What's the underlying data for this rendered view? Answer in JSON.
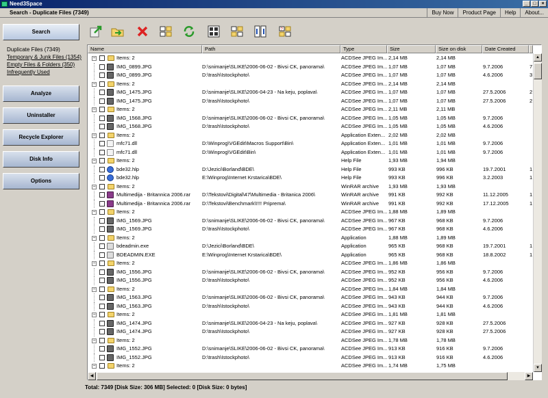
{
  "window": {
    "title": "Need3Space"
  },
  "header_bar": {
    "crumb": "Search - Duplicate Files (7349)",
    "menu": [
      "Buy Now",
      "Product Page",
      "Help",
      "About..."
    ]
  },
  "sidebar": {
    "search": "Search",
    "sub_items": [
      {
        "label": "Duplicate Files (7349)",
        "link": false
      },
      {
        "label": "Temporary & Junk Files (1354)",
        "link": true
      },
      {
        "label": "Empty Files & Folders (350)",
        "link": true
      },
      {
        "label": "Infrequently Used",
        "link": true
      }
    ],
    "analyze": "Analyze",
    "uninstaller": "Uninstaller",
    "recycle": "Recycle Explorer",
    "diskinfo": "Disk Info",
    "options": "Options"
  },
  "toolbar_icons": [
    "export-icon",
    "folder-move-icon",
    "delete-icon",
    "view-details-icon",
    "refresh-icon",
    "select-all-icon",
    "select-none-icon",
    "select-invert-icon",
    "help-icon"
  ],
  "columns": [
    "Name",
    "Path",
    "Type",
    "Size",
    "Size on disk",
    "Date Created",
    ""
  ],
  "rows": [
    {
      "kind": "group",
      "name": "Items: 2",
      "type": "ACDSee JPEG Im...",
      "size": "2,14 MB",
      "disk": "2,14 MB",
      "date": "",
      "extra": ""
    },
    {
      "kind": "file",
      "icon": "jpg",
      "name": "IMG_0899.JPG",
      "path": "D:\\snimanje\\SLIKE\\2006-06-02 - Bivsi CK, panorama\\",
      "type": "ACDSee JPEG Im...",
      "size": "1,07 MB",
      "disk": "1,07 MB",
      "date": "9.7.2006",
      "extra": "7"
    },
    {
      "kind": "file",
      "icon": "jpg",
      "name": "IMG_0899.JPG",
      "path": "D:\\trash\\Istockphoto\\",
      "type": "ACDSee JPEG Im...",
      "size": "1,07 MB",
      "disk": "1,07 MB",
      "date": "4.6.2006",
      "extra": "3"
    },
    {
      "kind": "group",
      "name": "Items: 2",
      "type": "ACDSee JPEG Im...",
      "size": "2,14 MB",
      "disk": "2,14 MB",
      "date": "",
      "extra": ""
    },
    {
      "kind": "file",
      "icon": "jpg",
      "name": "IMG_1475.JPG",
      "path": "D:\\snimanje\\SLIKE\\2006-04-23 - Na keju, poplava\\",
      "type": "ACDSee JPEG Im...",
      "size": "1,07 MB",
      "disk": "1,07 MB",
      "date": "27.5.2006",
      "extra": "2"
    },
    {
      "kind": "file",
      "icon": "jpg",
      "name": "IMG_1475.JPG",
      "path": "D:\\trash\\Istockphoto\\",
      "type": "ACDSee JPEG Im...",
      "size": "1,07 MB",
      "disk": "1,07 MB",
      "date": "27.5.2006",
      "extra": "2"
    },
    {
      "kind": "group",
      "name": "Items: 2",
      "type": "ACDSee JPEG Im...",
      "size": "2,11 MB",
      "disk": "2,11 MB",
      "date": "",
      "extra": ""
    },
    {
      "kind": "file",
      "icon": "jpg",
      "name": "IMG_1568.JPG",
      "path": "D:\\snimanje\\SLIKE\\2006-06-02 - Bivsi CK, panorama\\",
      "type": "ACDSee JPEG Im...",
      "size": "1,05 MB",
      "disk": "1,05 MB",
      "date": "9.7.2006",
      "extra": ""
    },
    {
      "kind": "file",
      "icon": "jpg",
      "name": "IMG_1568.JPG",
      "path": "D:\\trash\\Istockphoto\\",
      "type": "ACDSee JPEG Im...",
      "size": "1,05 MB",
      "disk": "1,05 MB",
      "date": "4.6.2006",
      "extra": ""
    },
    {
      "kind": "group",
      "name": "Items: 2",
      "type": "Application Exten...",
      "size": "2,02 MB",
      "disk": "2,02 MB",
      "date": "",
      "extra": ""
    },
    {
      "kind": "file",
      "icon": "dll",
      "name": "mfc71.dll",
      "path": "D:\\Winprog\\VGEdit\\Macros Support\\Bin\\",
      "type": "Application Exten...",
      "size": "1,01 MB",
      "disk": "1,01 MB",
      "date": "9.7.2006",
      "extra": ""
    },
    {
      "kind": "file",
      "icon": "dll",
      "name": "mfc71.dll",
      "path": "D:\\Winprog\\VGEdit\\Bin\\",
      "type": "Application Exten...",
      "size": "1,01 MB",
      "disk": "1,01 MB",
      "date": "9.7.2006",
      "extra": ""
    },
    {
      "kind": "group",
      "name": "Items: 2",
      "type": "Help File",
      "size": "1,93 MB",
      "disk": "1,94 MB",
      "date": "",
      "extra": ""
    },
    {
      "kind": "file",
      "icon": "hlp",
      "name": "bde32.hlp",
      "path": "D:\\Jezici\\Borland\\BDE\\",
      "type": "Help File",
      "size": "993 KB",
      "disk": "996 KB",
      "date": "19.7.2001",
      "extra": "1"
    },
    {
      "kind": "file",
      "icon": "hlp",
      "name": "bde32.hlp",
      "path": "E:\\Winprog\\Internet Krstarica\\BDE\\",
      "type": "Help File",
      "size": "993 KB",
      "disk": "996 KB",
      "date": "3.2.2003",
      "extra": "1"
    },
    {
      "kind": "group",
      "name": "Items: 2",
      "type": "WinRAR archive",
      "size": "1,93 MB",
      "disk": "1,93 MB",
      "date": "",
      "extra": ""
    },
    {
      "kind": "file",
      "icon": "rar",
      "name": "Multimedija - Britannica 2006.rar",
      "path": "D:\\Tekstovi\\Digital\\47\\Multimedia - Britanica 2006\\",
      "type": "WinRAR archive",
      "size": "991 KB",
      "disk": "992 KB",
      "date": "11.12.2005",
      "extra": "1"
    },
    {
      "kind": "file",
      "icon": "rar",
      "name": "Multimedija - Britannica 2006.rar",
      "path": "D:\\Tekstovi\\Benchmark\\!!!! Priprema\\",
      "type": "WinRAR archive",
      "size": "991 KB",
      "disk": "992 KB",
      "date": "17.12.2005",
      "extra": "1"
    },
    {
      "kind": "group",
      "name": "Items: 2",
      "type": "ACDSee JPEG Im...",
      "size": "1,88 MB",
      "disk": "1,89 MB",
      "date": "",
      "extra": ""
    },
    {
      "kind": "file",
      "icon": "jpg",
      "name": "IMG_1569.JPG",
      "path": "D:\\snimanje\\SLIKE\\2006-06-02 - Bivsi CK, panorama\\",
      "type": "ACDSee JPEG Im...",
      "size": "967 KB",
      "disk": "968 KB",
      "date": "9.7.2006",
      "extra": ""
    },
    {
      "kind": "file",
      "icon": "jpg",
      "name": "IMG_1569.JPG",
      "path": "D:\\trash\\Istockphoto\\",
      "type": "ACDSee JPEG Im...",
      "size": "967 KB",
      "disk": "968 KB",
      "date": "4.6.2006",
      "extra": ""
    },
    {
      "kind": "group",
      "name": "Items: 2",
      "type": "Application",
      "size": "1,88 MB",
      "disk": "1,89 MB",
      "date": "",
      "extra": ""
    },
    {
      "kind": "file",
      "icon": "exe",
      "name": "bdeadmin.exe",
      "path": "D:\\Jezici\\Borland\\BDE\\",
      "type": "Application",
      "size": "965 KB",
      "disk": "968 KB",
      "date": "19.7.2001",
      "extra": "1"
    },
    {
      "kind": "file",
      "icon": "exe",
      "name": "BDEADMIN.EXE",
      "path": "E:\\Winprog\\Internet Krstarica\\BDE\\",
      "type": "Application",
      "size": "965 KB",
      "disk": "968 KB",
      "date": "18.8.2002",
      "extra": "1"
    },
    {
      "kind": "group",
      "name": "Items: 2",
      "type": "ACDSee JPEG Im...",
      "size": "1,86 MB",
      "disk": "1,86 MB",
      "date": "",
      "extra": ""
    },
    {
      "kind": "file",
      "icon": "jpg",
      "name": "IMG_1556.JPG",
      "path": "D:\\snimanje\\SLIKE\\2006-06-02 - Bivsi CK, panorama\\",
      "type": "ACDSee JPEG Im...",
      "size": "952 KB",
      "disk": "956 KB",
      "date": "9.7.2006",
      "extra": ""
    },
    {
      "kind": "file",
      "icon": "jpg",
      "name": "IMG_1556.JPG",
      "path": "D:\\trash\\Istockphoto\\",
      "type": "ACDSee JPEG Im...",
      "size": "952 KB",
      "disk": "956 KB",
      "date": "4.6.2006",
      "extra": ""
    },
    {
      "kind": "group",
      "name": "Items: 2",
      "type": "ACDSee JPEG Im...",
      "size": "1,84 MB",
      "disk": "1,84 MB",
      "date": "",
      "extra": ""
    },
    {
      "kind": "file",
      "icon": "jpg",
      "name": "IMG_1563.JPG",
      "path": "D:\\snimanje\\SLIKE\\2006-06-02 - Bivsi CK, panorama\\",
      "type": "ACDSee JPEG Im...",
      "size": "943 KB",
      "disk": "944 KB",
      "date": "9.7.2006",
      "extra": ""
    },
    {
      "kind": "file",
      "icon": "jpg",
      "name": "IMG_1563.JPG",
      "path": "D:\\trash\\Istockphoto\\",
      "type": "ACDSee JPEG Im...",
      "size": "943 KB",
      "disk": "944 KB",
      "date": "4.6.2006",
      "extra": ""
    },
    {
      "kind": "group",
      "name": "Items: 2",
      "type": "ACDSee JPEG Im...",
      "size": "1,81 MB",
      "disk": "1,81 MB",
      "date": "",
      "extra": ""
    },
    {
      "kind": "file",
      "icon": "jpg",
      "name": "IMG_1474.JPG",
      "path": "D:\\snimanje\\SLIKE\\2006-04-23 - Na keju, poplava\\",
      "type": "ACDSee JPEG Im...",
      "size": "927 KB",
      "disk": "928 KB",
      "date": "27.5.2006",
      "extra": ""
    },
    {
      "kind": "file",
      "icon": "jpg",
      "name": "IMG_1474.JPG",
      "path": "D:\\trash\\Istockphoto\\",
      "type": "ACDSee JPEG Im...",
      "size": "927 KB",
      "disk": "928 KB",
      "date": "27.5.2006",
      "extra": ""
    },
    {
      "kind": "group",
      "name": "Items: 2",
      "type": "ACDSee JPEG Im...",
      "size": "1,78 MB",
      "disk": "1,78 MB",
      "date": "",
      "extra": ""
    },
    {
      "kind": "file",
      "icon": "jpg",
      "name": "IMG_1552.JPG",
      "path": "D:\\snimanje\\SLIKE\\2006-06-02 - Bivsi CK, panorama\\",
      "type": "ACDSee JPEG Im...",
      "size": "913 KB",
      "disk": "916 KB",
      "date": "9.7.2006",
      "extra": ""
    },
    {
      "kind": "file",
      "icon": "jpg",
      "name": "IMG_1552.JPG",
      "path": "D:\\trash\\Istockphoto\\",
      "type": "ACDSee JPEG Im...",
      "size": "913 KB",
      "disk": "916 KB",
      "date": "4.6.2006",
      "extra": ""
    },
    {
      "kind": "group",
      "name": "Items: 2",
      "type": "ACDSee JPEG Im...",
      "size": "1,74 MB",
      "disk": "1,75 MB",
      "date": "",
      "extra": ""
    }
  ],
  "status": "Total: 7349 [Disk Size: 306 MB] Selected: 0 [Disk Size: 0 bytes]"
}
